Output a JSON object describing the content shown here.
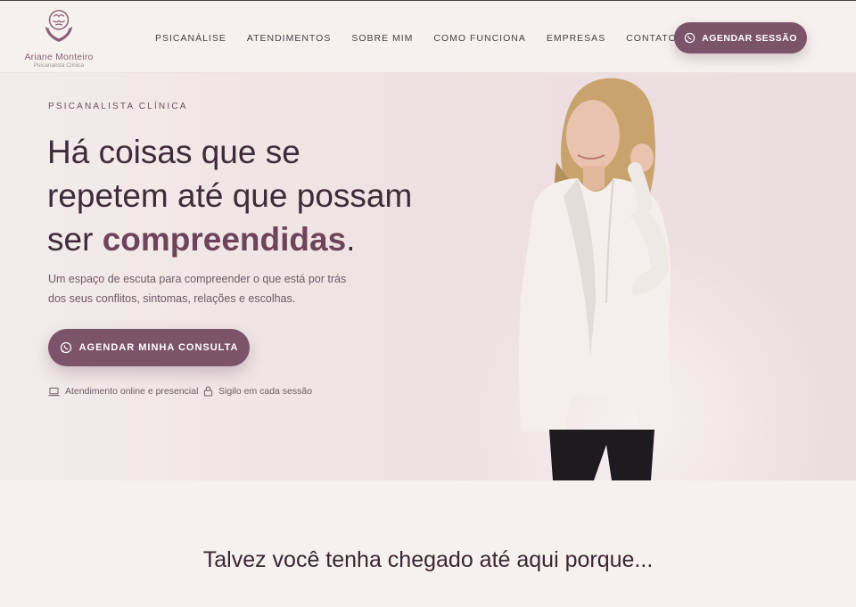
{
  "brand": {
    "name": "Ariane Monteiro",
    "subtitle": "Psicanalista Clínica"
  },
  "nav": {
    "items": [
      "PSICANÁLISE",
      "ATENDIMENTOS",
      "SOBRE MIM",
      "COMO FUNCIONA",
      "EMPRESAS",
      "CONTATO"
    ]
  },
  "header": {
    "cta_label": "AGENDAR SESSÃO"
  },
  "hero": {
    "eyebrow": "PSICANALISTA CLÍNICA",
    "headline_line1": "Há coisas que se",
    "headline_line2": "repetem até que possam",
    "headline_pre": "ser ",
    "headline_strong": "compreendidas",
    "headline_post": ".",
    "sub_line1": "Um espaço de escuta para compreender o que está por trás",
    "sub_line2": "dos seus conflitos, sintomas, relações e escolhas.",
    "cta_label": "AGENDAR MINHA CONSULTA",
    "features": [
      {
        "icon": "laptop-icon",
        "label": "Atendimento online e presencial"
      },
      {
        "icon": "lock-icon",
        "label": "Sigilo em cada sessão"
      }
    ]
  },
  "section2": {
    "title": "Talvez você tenha chegado até aqui porque..."
  },
  "colors": {
    "accent": "#7c5469",
    "text": "#3e2b38",
    "background": "#f6f1ef",
    "hero_bg": "#eedfe1"
  }
}
